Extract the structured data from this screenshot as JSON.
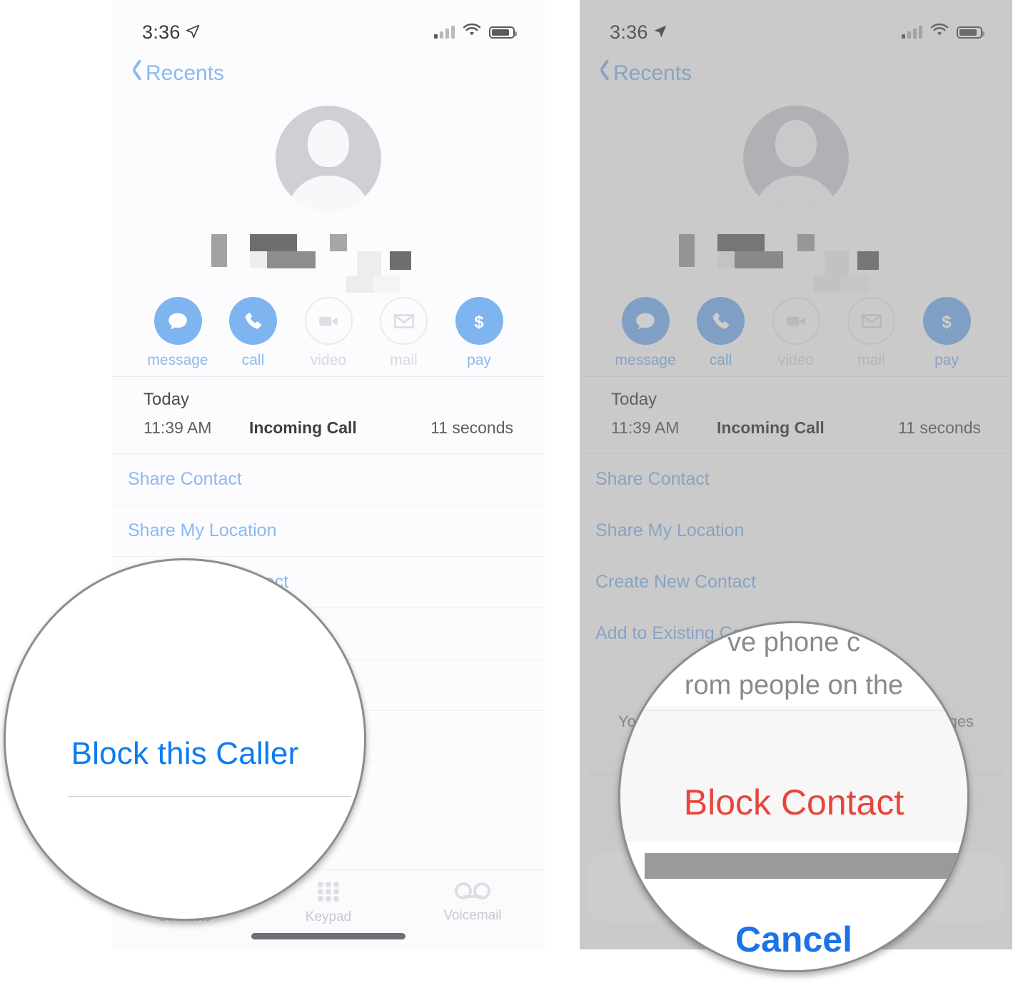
{
  "status_bar": {
    "time": "3:36",
    "location_icon": "location-arrow-icon",
    "signal_icon": "cellular-signal-icon",
    "wifi_icon": "wifi-icon",
    "battery_icon": "battery-icon"
  },
  "nav": {
    "back_label": "Recents",
    "back_icon": "chevron-left-icon"
  },
  "contact": {
    "avatar_icon": "default-person-avatar-icon",
    "name_redacted": true
  },
  "actions": [
    {
      "label": "message",
      "icon": "message-bubble-icon",
      "enabled": true
    },
    {
      "label": "call",
      "icon": "phone-handset-icon",
      "enabled": true
    },
    {
      "label": "video",
      "icon": "video-camera-icon",
      "enabled": false
    },
    {
      "label": "mail",
      "icon": "envelope-icon",
      "enabled": false
    },
    {
      "label": "pay",
      "icon": "dollar-sign-icon",
      "enabled": true
    }
  ],
  "call_log": {
    "day": "Today",
    "time": "11:39 AM",
    "kind": "Incoming Call",
    "duration": "11 seconds"
  },
  "list_items": [
    "Share Contact",
    "Share My Location",
    "Create New Contact",
    "Add to Existing Contact"
  ],
  "tabbar": [
    {
      "label": "Contacts",
      "icon": "contacts-people-icon"
    },
    {
      "label": "Keypad",
      "icon": "keypad-dots-icon"
    },
    {
      "label": "Voicemail",
      "icon": "voicemail-icon"
    }
  ],
  "action_sheet": {
    "message_line1": "You will no longer receive phone calls or messages",
    "message_line2": "from people on the block list.",
    "block_label": "Block Contact",
    "cancel_label": "Cancel"
  },
  "magnifier_left": {
    "callout_label": "Block this Caller"
  },
  "magnifier_right": {
    "msg_line1": "ve phone c",
    "msg_line2": "rom people on the",
    "block_label": "Block Contact",
    "cancel_label": "Cancel"
  },
  "colors": {
    "ios_blue": "#0a7cf0",
    "ios_blue_dim": "#8cb9ef",
    "ios_red": "#e8453c",
    "cancel_blue": "#1a73e8",
    "action_fill": "#7eb5f0",
    "disabled_gray": "#d7d9de"
  }
}
